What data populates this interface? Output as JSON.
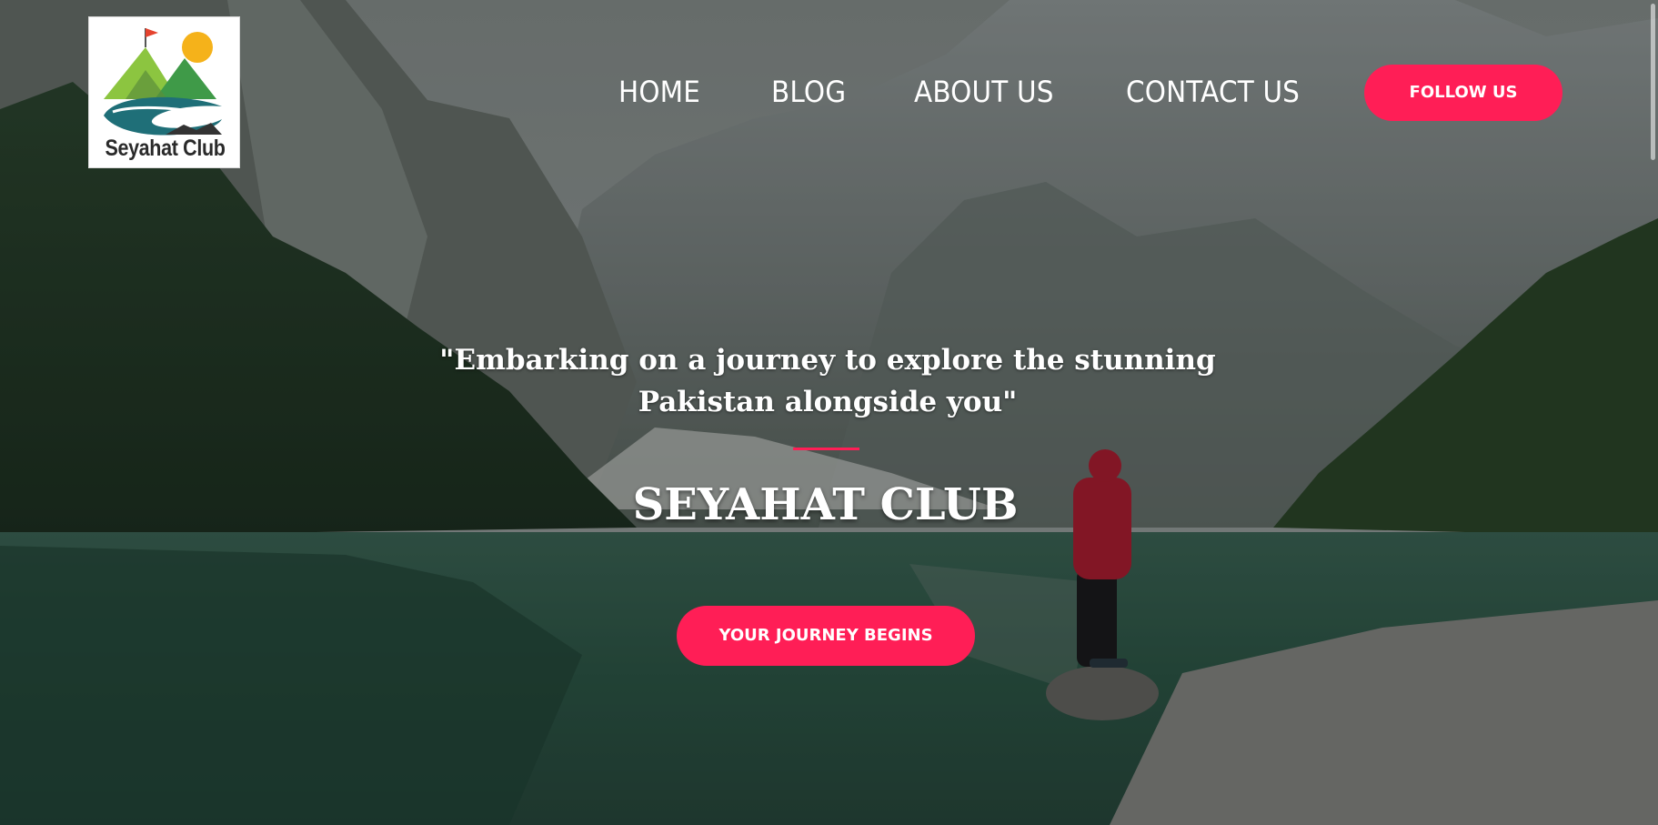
{
  "logo": {
    "text": "Seyahat Club",
    "alt": "Seyahat Club logo"
  },
  "nav": {
    "home": "HOME",
    "blog": "BLOG",
    "about": "ABOUT US",
    "contact": "CONTACT US",
    "follow": "FOLLOW US"
  },
  "hero": {
    "quote_line1": "\"Embarking on a journey to explore the stunning",
    "quote_line2": "Pakistan alongside you\"",
    "title": "SEYAHAT CLUB",
    "cta": "YOUR JOURNEY BEGINS",
    "background": "mountain-lake-hiker-photo"
  },
  "colors": {
    "accent": "#ff1e56",
    "text": "#ffffff",
    "logo_green": "#6aaa3a",
    "logo_teal": "#1f6f78",
    "logo_sun": "#f5b21a"
  }
}
